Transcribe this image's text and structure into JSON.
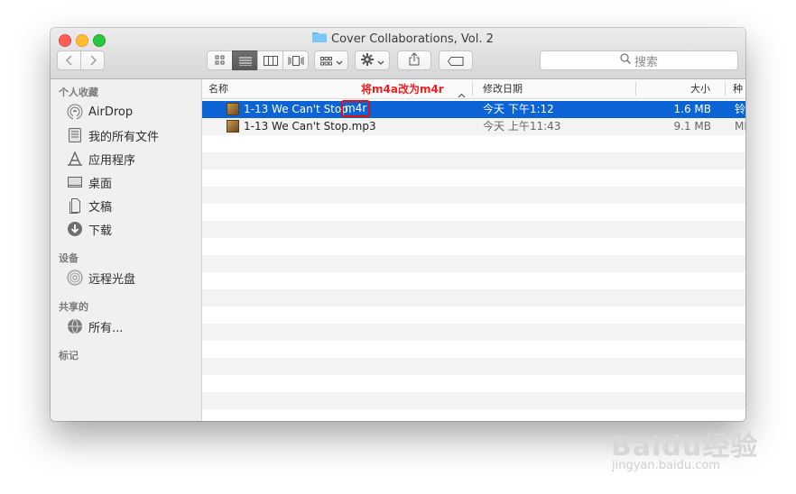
{
  "window": {
    "title": "Cover Collaborations, Vol. 2",
    "search_placeholder": "搜索"
  },
  "sidebar": {
    "favorites_header": "个人收藏",
    "favorites": [
      "AirDrop",
      "我的所有文件",
      "应用程序",
      "桌面",
      "文稿",
      "下载"
    ],
    "devices_header": "设备",
    "devices": [
      "远程光盘"
    ],
    "shared_header": "共享的",
    "shared": [
      "所有..."
    ],
    "tags_header": "标记"
  },
  "columns": {
    "name": "名称",
    "date": "修改日期",
    "size": "大小",
    "kind": "种类"
  },
  "files": [
    {
      "name": "1-13 We Can't Stop.",
      "ext": "m4r",
      "date": "今天 下午1:12",
      "size": "1.6 MB",
      "kind": "铃"
    },
    {
      "name": "1-13 We Can't Stop.mp3",
      "date": "今天 上午11:43",
      "size": "9.1 MB",
      "kind": "MP"
    }
  ],
  "annotation": "将m4a改为m4r",
  "watermark": {
    "logo": "Baidu经验",
    "url": "jingyan.baidu.com"
  },
  "colors": {
    "selection": "#0b63d5",
    "annotation": "#f01e1e"
  }
}
